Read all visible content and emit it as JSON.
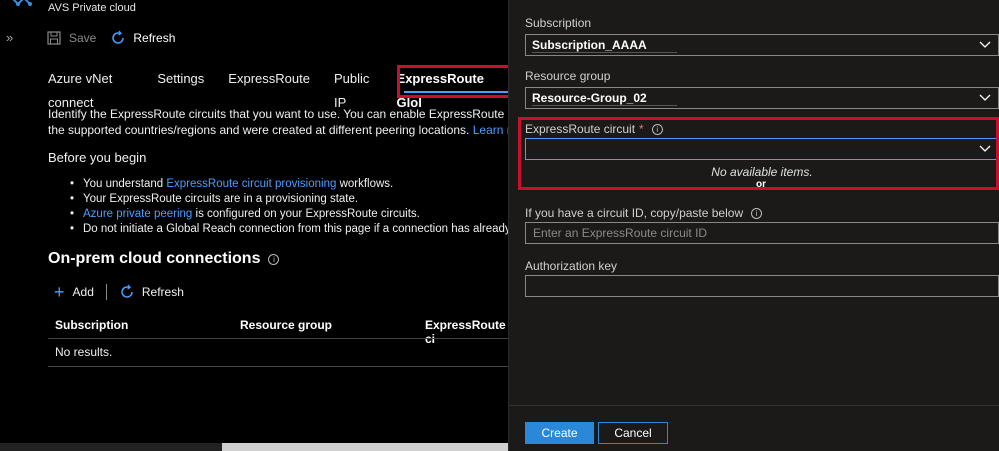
{
  "app": {
    "title": "AVS Private cloud"
  },
  "toolbar": {
    "save_label": "Save",
    "refresh_label": "Refresh"
  },
  "tabs": [
    {
      "label": "Azure vNet connect"
    },
    {
      "label": "Settings"
    },
    {
      "label": "ExpressRoute"
    },
    {
      "label": "Public IP"
    },
    {
      "label": "ExpressRoute Glol"
    }
  ],
  "intro": {
    "line1": "Identify the ExpressRoute circuits that you want to use. You can enable ExpressRoute Global",
    "line2": "the supported countries/regions and were created at different peering locations.",
    "learn_more": "Learn more"
  },
  "before": {
    "title": "Before you begin",
    "b1_pre": "You understand ",
    "b1_link": "ExpressRoute circuit provisioning",
    "b1_post": " workflows.",
    "b2": "Your ExpressRoute circuits are in a provisioning state.",
    "b3_link": "Azure private peering",
    "b3_post": " is configured on your ExpressRoute circuits.",
    "b4": "Do not initiate a Global Reach connection from this page if a connection has already b"
  },
  "onprem": {
    "title": "On-prem cloud connections",
    "add_label": "Add",
    "refresh_label": "Refresh",
    "columns": [
      "Subscription",
      "Resource group",
      "ExpressRoute ci"
    ],
    "empty": "No results."
  },
  "panel": {
    "subscription_label": "Subscription",
    "subscription_value": "Subscription_AAAA",
    "rg_label": "Resource group",
    "rg_value": "Resource-Group_02",
    "circuit_label": "ExpressRoute circuit",
    "required_mark": "*",
    "no_items": "No available items.",
    "or_text": "or",
    "circuit_id_label": "If you have a circuit ID, copy/paste below",
    "circuit_id_placeholder": "Enter an ExpressRoute circuit ID",
    "auth_label": "Authorization key",
    "create_label": "Create",
    "cancel_label": "Cancel"
  },
  "colors": {
    "accent": "#4a9eff",
    "highlight": "#c8102e",
    "primary_button": "#2b88d8"
  }
}
